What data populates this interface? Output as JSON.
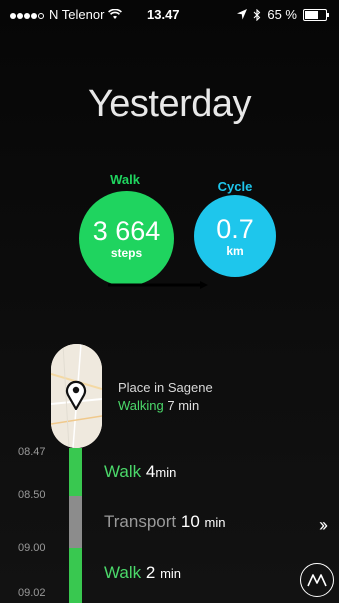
{
  "status_bar": {
    "carrier": "N Telenor",
    "time": "13.47",
    "battery": "65 %",
    "battery_level": 0.65
  },
  "title": "Yesterday",
  "activities": {
    "walk": {
      "label": "Walk",
      "value": "3 664",
      "unit": "steps",
      "color": "#1fd45f"
    },
    "cycle": {
      "label": "Cycle",
      "value": "0.7",
      "unit": "km",
      "color": "#1ec6ec"
    }
  },
  "place": {
    "name": "Place in Sagene",
    "activity": "Walking",
    "duration": "7 min",
    "activity_color": "#4bd86a"
  },
  "timeline": {
    "times": [
      "08.47",
      "08.50",
      "09.00",
      "09.02"
    ],
    "items": [
      {
        "label": "Walk",
        "value": "4",
        "unit": "min",
        "color": "#4bd86a"
      },
      {
        "label": "Transport",
        "value": "10",
        "unit": "min",
        "color": "#9a9a9a"
      },
      {
        "label": "Walk",
        "value": "2",
        "unit": "min",
        "color": "#4bd86a"
      }
    ]
  },
  "icons": {
    "signal": "signal-dots-icon",
    "wifi": "wifi-icon",
    "location": "location-arrow-icon",
    "bluetooth": "bluetooth-icon",
    "battery": "battery-icon",
    "pin": "map-pin-icon",
    "forward": "double-chevron-right-icon",
    "logo": "moves-logo-icon"
  }
}
